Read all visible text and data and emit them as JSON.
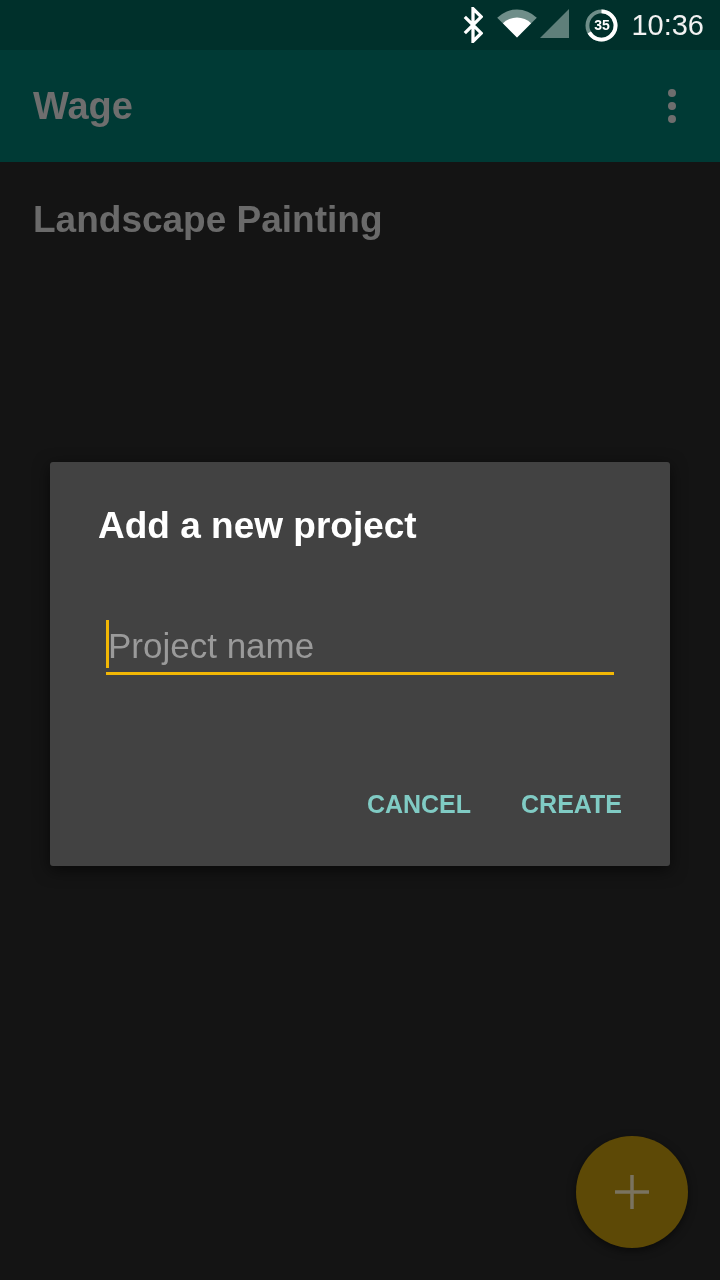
{
  "status_bar": {
    "battery_saver": "35",
    "time": "10:36"
  },
  "app_bar": {
    "title": "Wage"
  },
  "projects": [
    {
      "name": "Landscape Painting"
    }
  ],
  "dialog": {
    "title": "Add a new project",
    "field": {
      "placeholder": "Project name",
      "focused": true
    },
    "buttons": [
      "CANCEL",
      "CREATE"
    ]
  }
}
